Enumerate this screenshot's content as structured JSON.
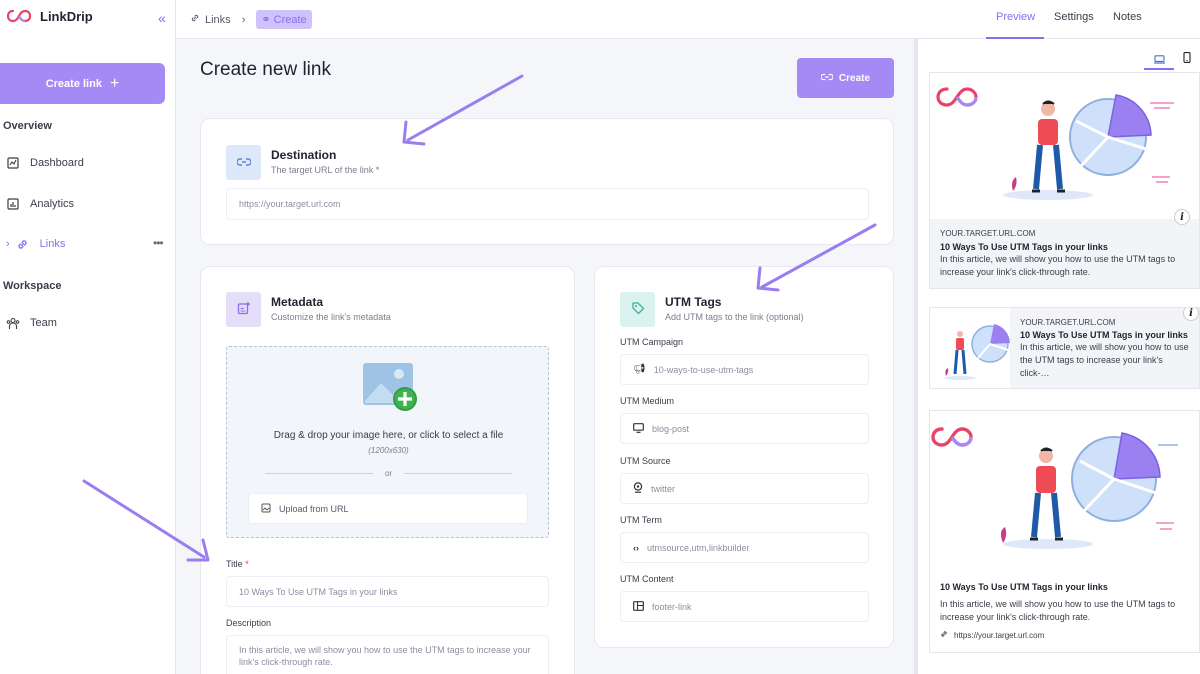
{
  "app": {
    "name": "LinkDrip"
  },
  "sidebar": {
    "create_link_label": "Create link",
    "overview_label": "Overview",
    "items": [
      {
        "label": "Dashboard",
        "icon": "dashboard-icon"
      },
      {
        "label": "Analytics",
        "icon": "analytics-icon"
      },
      {
        "label": "Links",
        "icon": "link-icon"
      }
    ],
    "workspace_label": "Workspace",
    "team_label": "Team"
  },
  "breadcrumb": {
    "links": "Links",
    "current": "Create"
  },
  "tabs": [
    "Preview",
    "Settings",
    "Notes"
  ],
  "main": {
    "title": "Create new link",
    "create_button": "Create",
    "destination": {
      "title": "Destination",
      "subtitle": "The target URL of the link",
      "placeholder": "https://your.target.url.com"
    },
    "metadata": {
      "title": "Metadata",
      "subtitle": "Customize the link's metadata",
      "drop_text": "Drag & drop your image here, or click to select a file",
      "drop_size": "(1200x630)",
      "or": "or",
      "upload_url": "Upload from URL",
      "title_label": "Title",
      "title_value": "10 Ways To Use UTM Tags in your links",
      "description_label": "Description",
      "description_value": "In this article, we will show you how to use the UTM tags to increase your link's click-through rate."
    },
    "utm": {
      "title": "UTM Tags",
      "subtitle": "Add UTM tags to the link (optional)",
      "fields": [
        {
          "label": "UTM Campaign",
          "value": "10-ways-to-use-utm-tags",
          "icon": "megaphone-icon"
        },
        {
          "label": "UTM Medium",
          "value": "blog-post",
          "icon": "monitor-icon"
        },
        {
          "label": "UTM Source",
          "value": "twitter",
          "icon": "location-pin-icon"
        },
        {
          "label": "UTM Term",
          "value": "utmsource,utm,linkbuilder",
          "icon": "code-icon"
        },
        {
          "label": "UTM Content",
          "value": "footer-link",
          "icon": "layout-icon"
        }
      ]
    }
  },
  "preview": {
    "domain": "YOUR.TARGET.URL.COM",
    "title": "10 Ways To Use UTM Tags in your links",
    "description": "In this article, we will show you how to use the UTM tags to increase your link's click-through rate.",
    "url": "https://your.target.url.com",
    "compact_description": "In this article, we will show you how to use the UTM tags to increase your link's click-…"
  },
  "colors": {
    "accent": "#8a6df0",
    "accent_light": "#a58af5"
  }
}
